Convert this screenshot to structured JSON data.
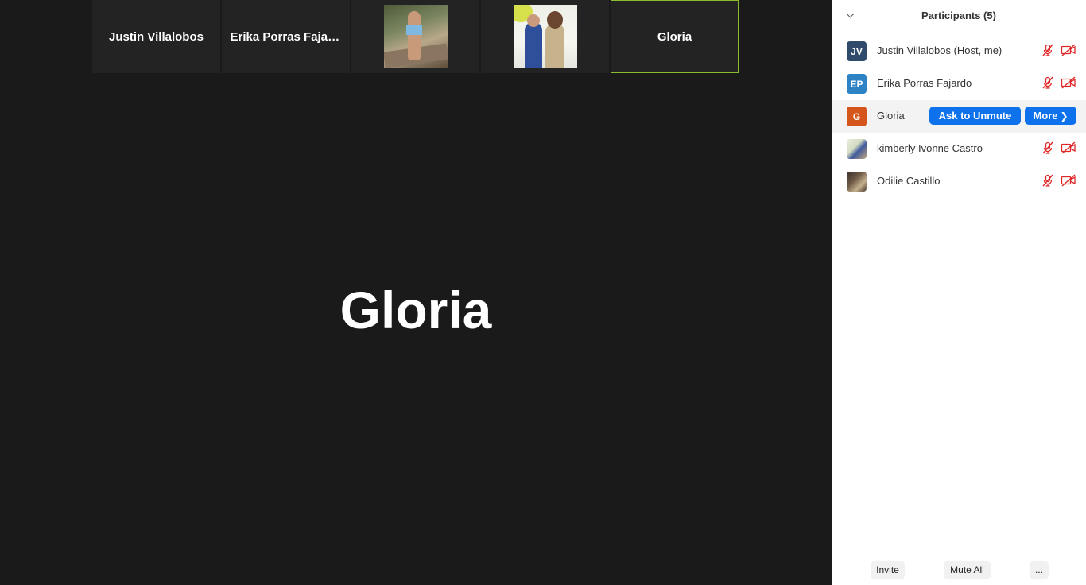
{
  "thumbnails": {
    "justin": {
      "name": "Justin Villalobos"
    },
    "erika": {
      "name": "Erika  Porras  Fajardo"
    },
    "gloria": {
      "name": "Gloria"
    }
  },
  "speaker": {
    "name": "Gloria"
  },
  "panel": {
    "title": "Participants (5)",
    "participants": [
      {
        "initials": "JV",
        "name": "Justin Villalobos (Host, me)",
        "avatar_color": "#2f4a6b"
      },
      {
        "initials": "EP",
        "name": "Erika Porras Fajardo",
        "avatar_color": "#2e83c4"
      },
      {
        "initials": "G",
        "name": "Gloria",
        "avatar_color": "#d4561c"
      },
      {
        "initials": "",
        "name": "kimberly Ivonne Castro",
        "avatar_color": ""
      },
      {
        "initials": "",
        "name": "Odilie Castillo",
        "avatar_color": ""
      }
    ],
    "ask_to_unmute_label": "Ask to Unmute",
    "more_label": "More",
    "footer": {
      "invite": "Invite",
      "mute_all": "Mute All",
      "more": "..."
    }
  },
  "colors": {
    "background": "#1a1a1a",
    "tile": "#232323",
    "active_speaker_border": "#8dbb2e",
    "accent_blue": "#0e72ed",
    "muted_red": "#e02828"
  },
  "icons": [
    "chevron-down-icon",
    "mic-muted-icon",
    "video-off-icon",
    "chevron-right-icon"
  ]
}
